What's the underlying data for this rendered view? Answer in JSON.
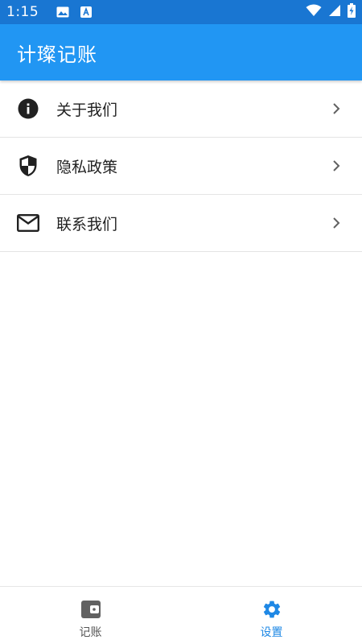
{
  "status_bar": {
    "time": "1:15",
    "left_icons": [
      "image-icon",
      "a-text-icon"
    ],
    "right_icons": [
      "wifi-icon",
      "signal-icon",
      "battery-charging-icon"
    ]
  },
  "app_bar": {
    "title": "计璨记账",
    "color": "#2196f3"
  },
  "settings": {
    "items": [
      {
        "label": "关于我们",
        "icon": "info-icon"
      },
      {
        "label": "隐私政策",
        "icon": "shield-icon"
      },
      {
        "label": "联系我们",
        "icon": "mail-icon"
      }
    ]
  },
  "bottom_nav": {
    "items": [
      {
        "label": "记账",
        "icon": "wallet-icon",
        "active": false
      },
      {
        "label": "设置",
        "icon": "gear-icon",
        "active": true
      }
    ],
    "active_color": "#1e88e5"
  }
}
